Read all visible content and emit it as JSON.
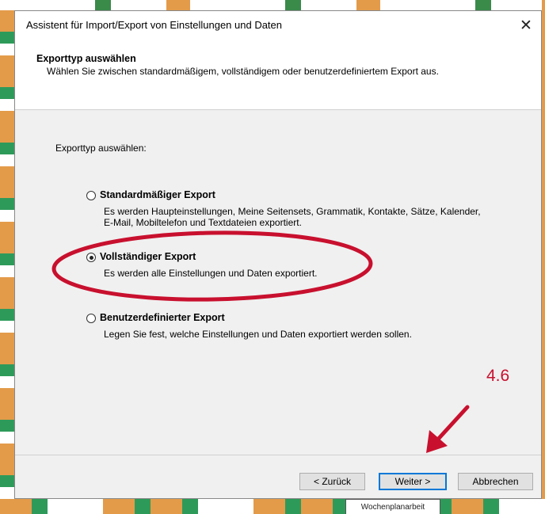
{
  "dialog": {
    "title": "Assistent für Import/Export von Einstellungen und Daten",
    "close_glyph": "✕"
  },
  "header": {
    "title": "Exporttyp auswählen",
    "description": "Wählen Sie zwischen standardmäßigem, vollständigem oder benutzerdefiniertem Export aus."
  },
  "section_label": "Exporttyp auswählen:",
  "options": [
    {
      "title": "Standardmäßiger Export",
      "description": "Es werden Haupteinstellungen, Meine Seitensets, Grammatik, Kontakte, Sätze, Kalender, E-Mail, Mobiltelefon und Textdateien exportiert.",
      "selected": false
    },
    {
      "title": "Vollständiger Export",
      "description": "Es werden alle Einstellungen und Daten exportiert.",
      "selected": true
    },
    {
      "title": "Benutzerdefinierter Export",
      "description": "Legen Sie fest, welche Einstellungen und Daten exportiert werden sollen.",
      "selected": false
    }
  ],
  "buttons": {
    "back": "< Zurück",
    "next": "Weiter >",
    "cancel": "Abbrechen"
  },
  "annotation": {
    "step_number": "4.6",
    "color": "#c8102e"
  },
  "background": {
    "label": "Wochenplanarbeit"
  }
}
